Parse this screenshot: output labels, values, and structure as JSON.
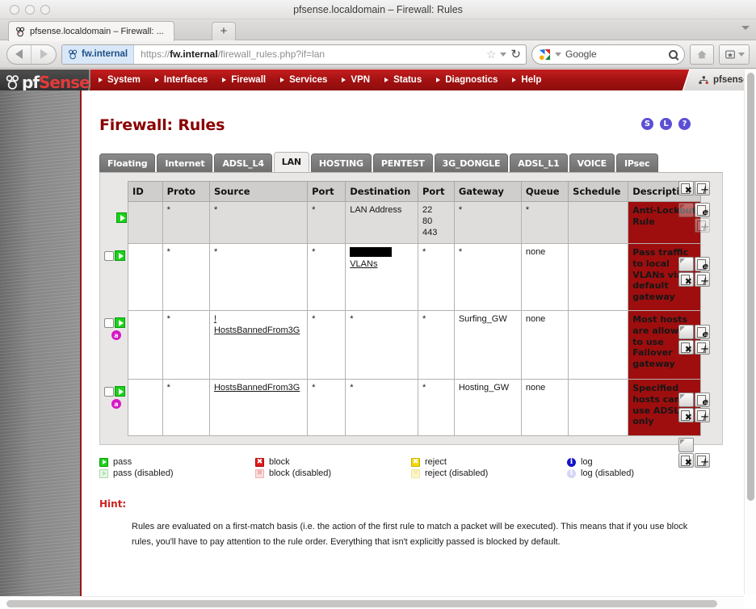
{
  "window": {
    "title": "pfsense.localdomain – Firewall: Rules"
  },
  "browser": {
    "tab_label": "pfsense.localdomain – Firewall: ...",
    "newtab_label": "+",
    "identity_label": "fw.internal",
    "url_prefix": "https://",
    "url_host": "fw.internal",
    "url_path": "/firewall_rules.php?if=lan",
    "search_engine": "Google",
    "reload_glyph": "↻"
  },
  "nav": {
    "brand_pf": "pf",
    "brand_sense": "Sense",
    "items": [
      "System",
      "Interfaces",
      "Firewall",
      "Services",
      "VPN",
      "Status",
      "Diagnostics",
      "Help"
    ],
    "user_label": "pfsense."
  },
  "page": {
    "title": "Firewall: Rules",
    "corner_icons": [
      "S",
      "L",
      "?"
    ]
  },
  "interface_tabs": [
    {
      "label": "Floating",
      "active": false
    },
    {
      "label": "Internet",
      "active": false
    },
    {
      "label": "ADSL_L4",
      "active": false
    },
    {
      "label": "LAN",
      "active": true
    },
    {
      "label": "HOSTING",
      "active": false
    },
    {
      "label": "PENTEST",
      "active": false
    },
    {
      "label": "3G_DONGLE",
      "active": false
    },
    {
      "label": "ADSL_L1",
      "active": false
    },
    {
      "label": "VOICE",
      "active": false
    },
    {
      "label": "IPsec",
      "active": false
    }
  ],
  "table": {
    "columns": [
      "ID",
      "Proto",
      "Source",
      "Port",
      "Destination",
      "Port",
      "Gateway",
      "Queue",
      "Schedule",
      "Description"
    ],
    "rows": [
      {
        "id": "",
        "proto": "*",
        "source": "*",
        "src_port": "*",
        "destination": "LAN Address",
        "dst_port": "22\n80\n443",
        "gateway": "*",
        "queue": "*",
        "schedule": "",
        "description": "Anti-Lockout Rule",
        "action": "pass",
        "selectable": false,
        "advanced": false,
        "redacted_destination": false
      },
      {
        "id": "",
        "proto": "*",
        "source": "*",
        "src_port": "*",
        "destination": "VLANs",
        "dst_port": "*",
        "gateway": "*",
        "queue": "none",
        "schedule": "",
        "description": "Pass traffic to local VLANs via default gateway",
        "action": "pass",
        "selectable": true,
        "advanced": false,
        "redacted_destination": true
      },
      {
        "id": "",
        "proto": "*",
        "source": "! HostsBannedFrom3G",
        "src_port": "*",
        "destination": "*",
        "dst_port": "*",
        "gateway": "Surfing_GW",
        "queue": "none",
        "schedule": "",
        "description": "Most hosts are allowed to use Failover gateway",
        "action": "pass",
        "selectable": true,
        "advanced": true,
        "redacted_destination": false
      },
      {
        "id": "",
        "proto": "*",
        "source": "HostsBannedFrom3G",
        "src_port": "*",
        "destination": "*",
        "dst_port": "*",
        "gateway": "Hosting_GW",
        "queue": "none",
        "schedule": "",
        "description": "Specified hosts can use ADSL only",
        "action": "pass",
        "selectable": true,
        "advanced": true,
        "redacted_destination": false
      }
    ]
  },
  "legend": [
    {
      "icon": "pass-icon",
      "label": "pass"
    },
    {
      "icon": "block-icon",
      "label": "block"
    },
    {
      "icon": "reject-icon",
      "label": "reject"
    },
    {
      "icon": "log-icon",
      "label": "log"
    },
    {
      "icon": "pass-disabled-icon",
      "label": "pass (disabled)"
    },
    {
      "icon": "block-disabled-icon",
      "label": "block (disabled)"
    },
    {
      "icon": "reject-disabled-icon",
      "label": "reject (disabled)"
    },
    {
      "icon": "log-disabled-icon",
      "label": "log (disabled)"
    }
  ],
  "hint": {
    "title": "Hint:",
    "text": "Rules are evaluated on a first-match basis (i.e. the action of the first rule to match a packet will be executed). This means that if you use block rules, you'll have to pay attention to the rule order. Everything that isn't explicitly passed is blocked by default."
  },
  "colors": {
    "nav_red": "#a31212",
    "description_red": "#9e0e0e",
    "title_red": "#8a0000",
    "hint_red": "#cc2222",
    "pass_green": "#18d318",
    "advanced_magenta": "#d816c6",
    "corner_icon_purple": "#5b4fd6"
  }
}
